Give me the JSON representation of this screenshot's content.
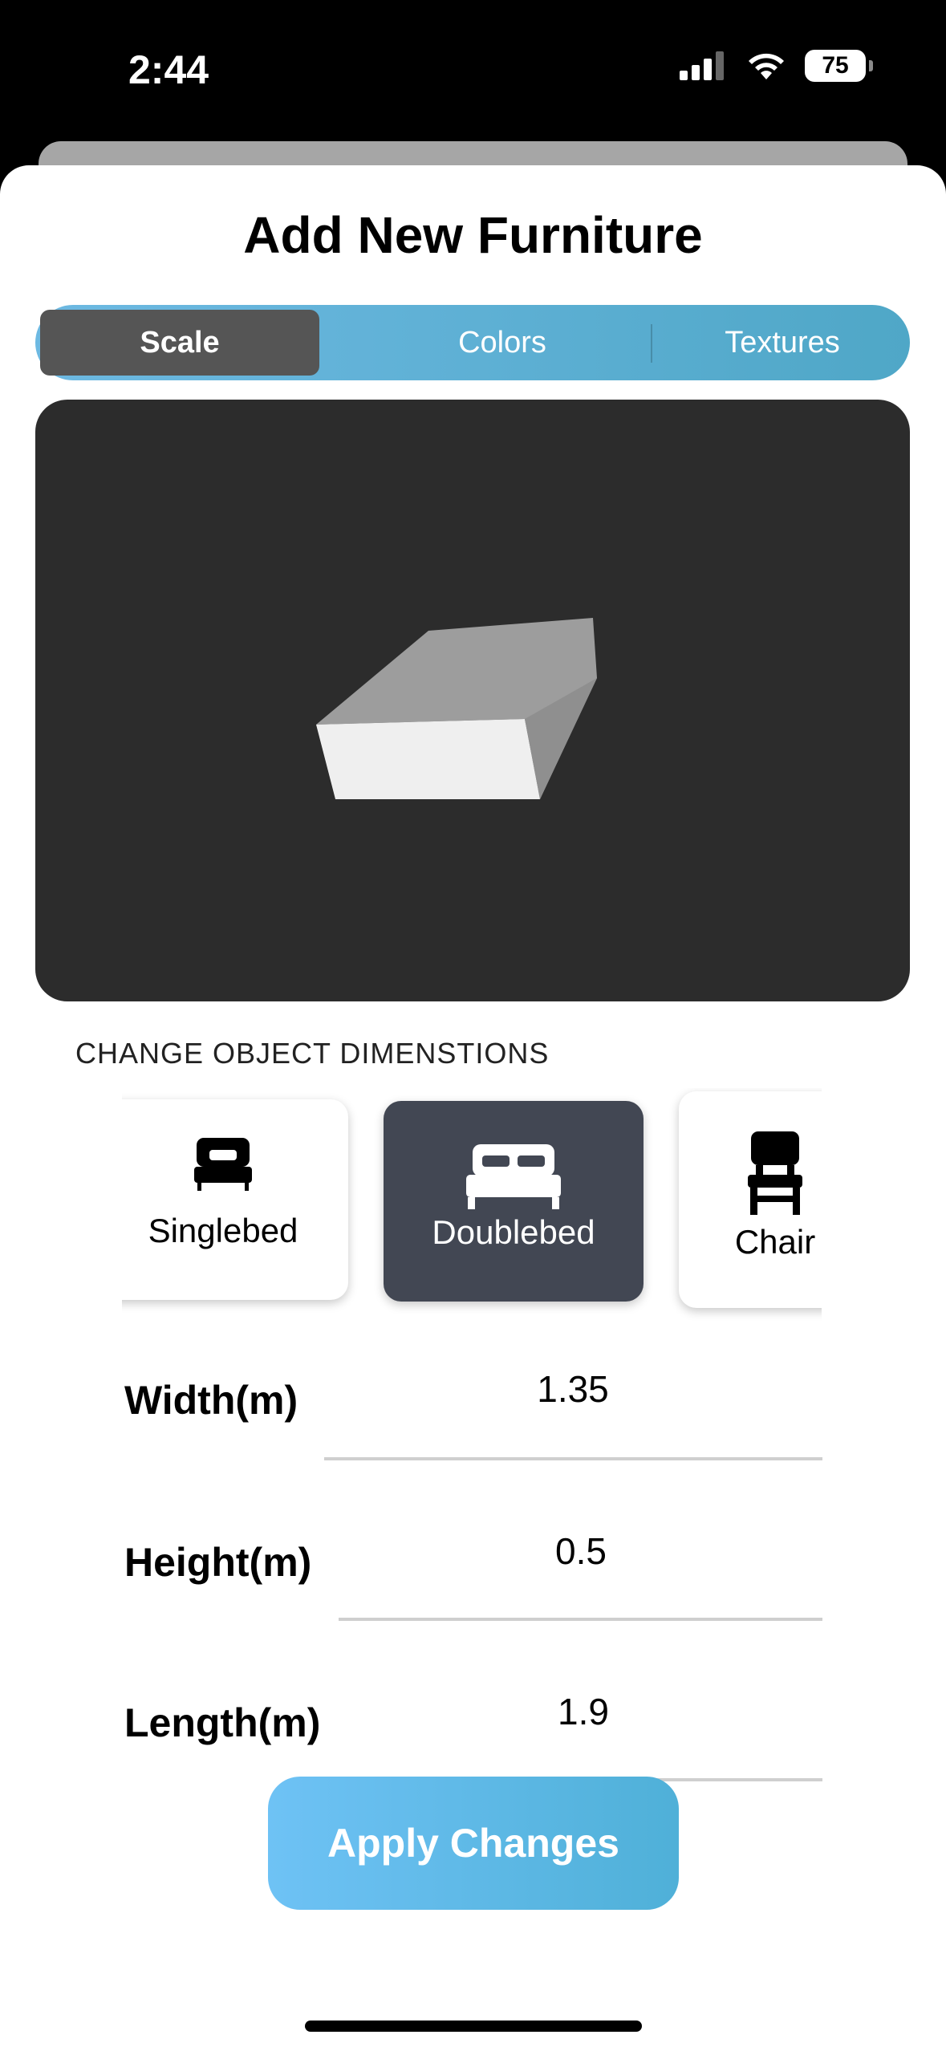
{
  "status_bar": {
    "time": "2:44",
    "battery_level": "75"
  },
  "sheet": {
    "title": "Add New Furniture"
  },
  "tabs": [
    {
      "label": "Scale",
      "selected": true
    },
    {
      "label": "Colors",
      "selected": false
    },
    {
      "label": "Textures",
      "selected": false
    }
  ],
  "preview": {
    "object": "3d-box-model"
  },
  "dimensions_section": {
    "label": "CHANGE OBJECT DIMENSTIONS",
    "types": [
      {
        "label": "Singlebed",
        "icon": "single-bed-icon",
        "selected": false
      },
      {
        "label": "Doublebed",
        "icon": "double-bed-icon",
        "selected": true
      },
      {
        "label": "Chair",
        "icon": "chair-icon",
        "selected": false
      }
    ],
    "fields": [
      {
        "label": "Width(m)",
        "value": "1.35"
      },
      {
        "label": "Height(m)",
        "value": "0.5"
      },
      {
        "label": "Length(m)",
        "value": "1.9"
      }
    ]
  },
  "apply_button": {
    "label": "Apply Changes"
  },
  "colors": {
    "accent_start": "#6ec2f5",
    "accent_end": "#4fb0d8",
    "selected_card": "#424753",
    "preview_bg": "#2c2c2c"
  }
}
